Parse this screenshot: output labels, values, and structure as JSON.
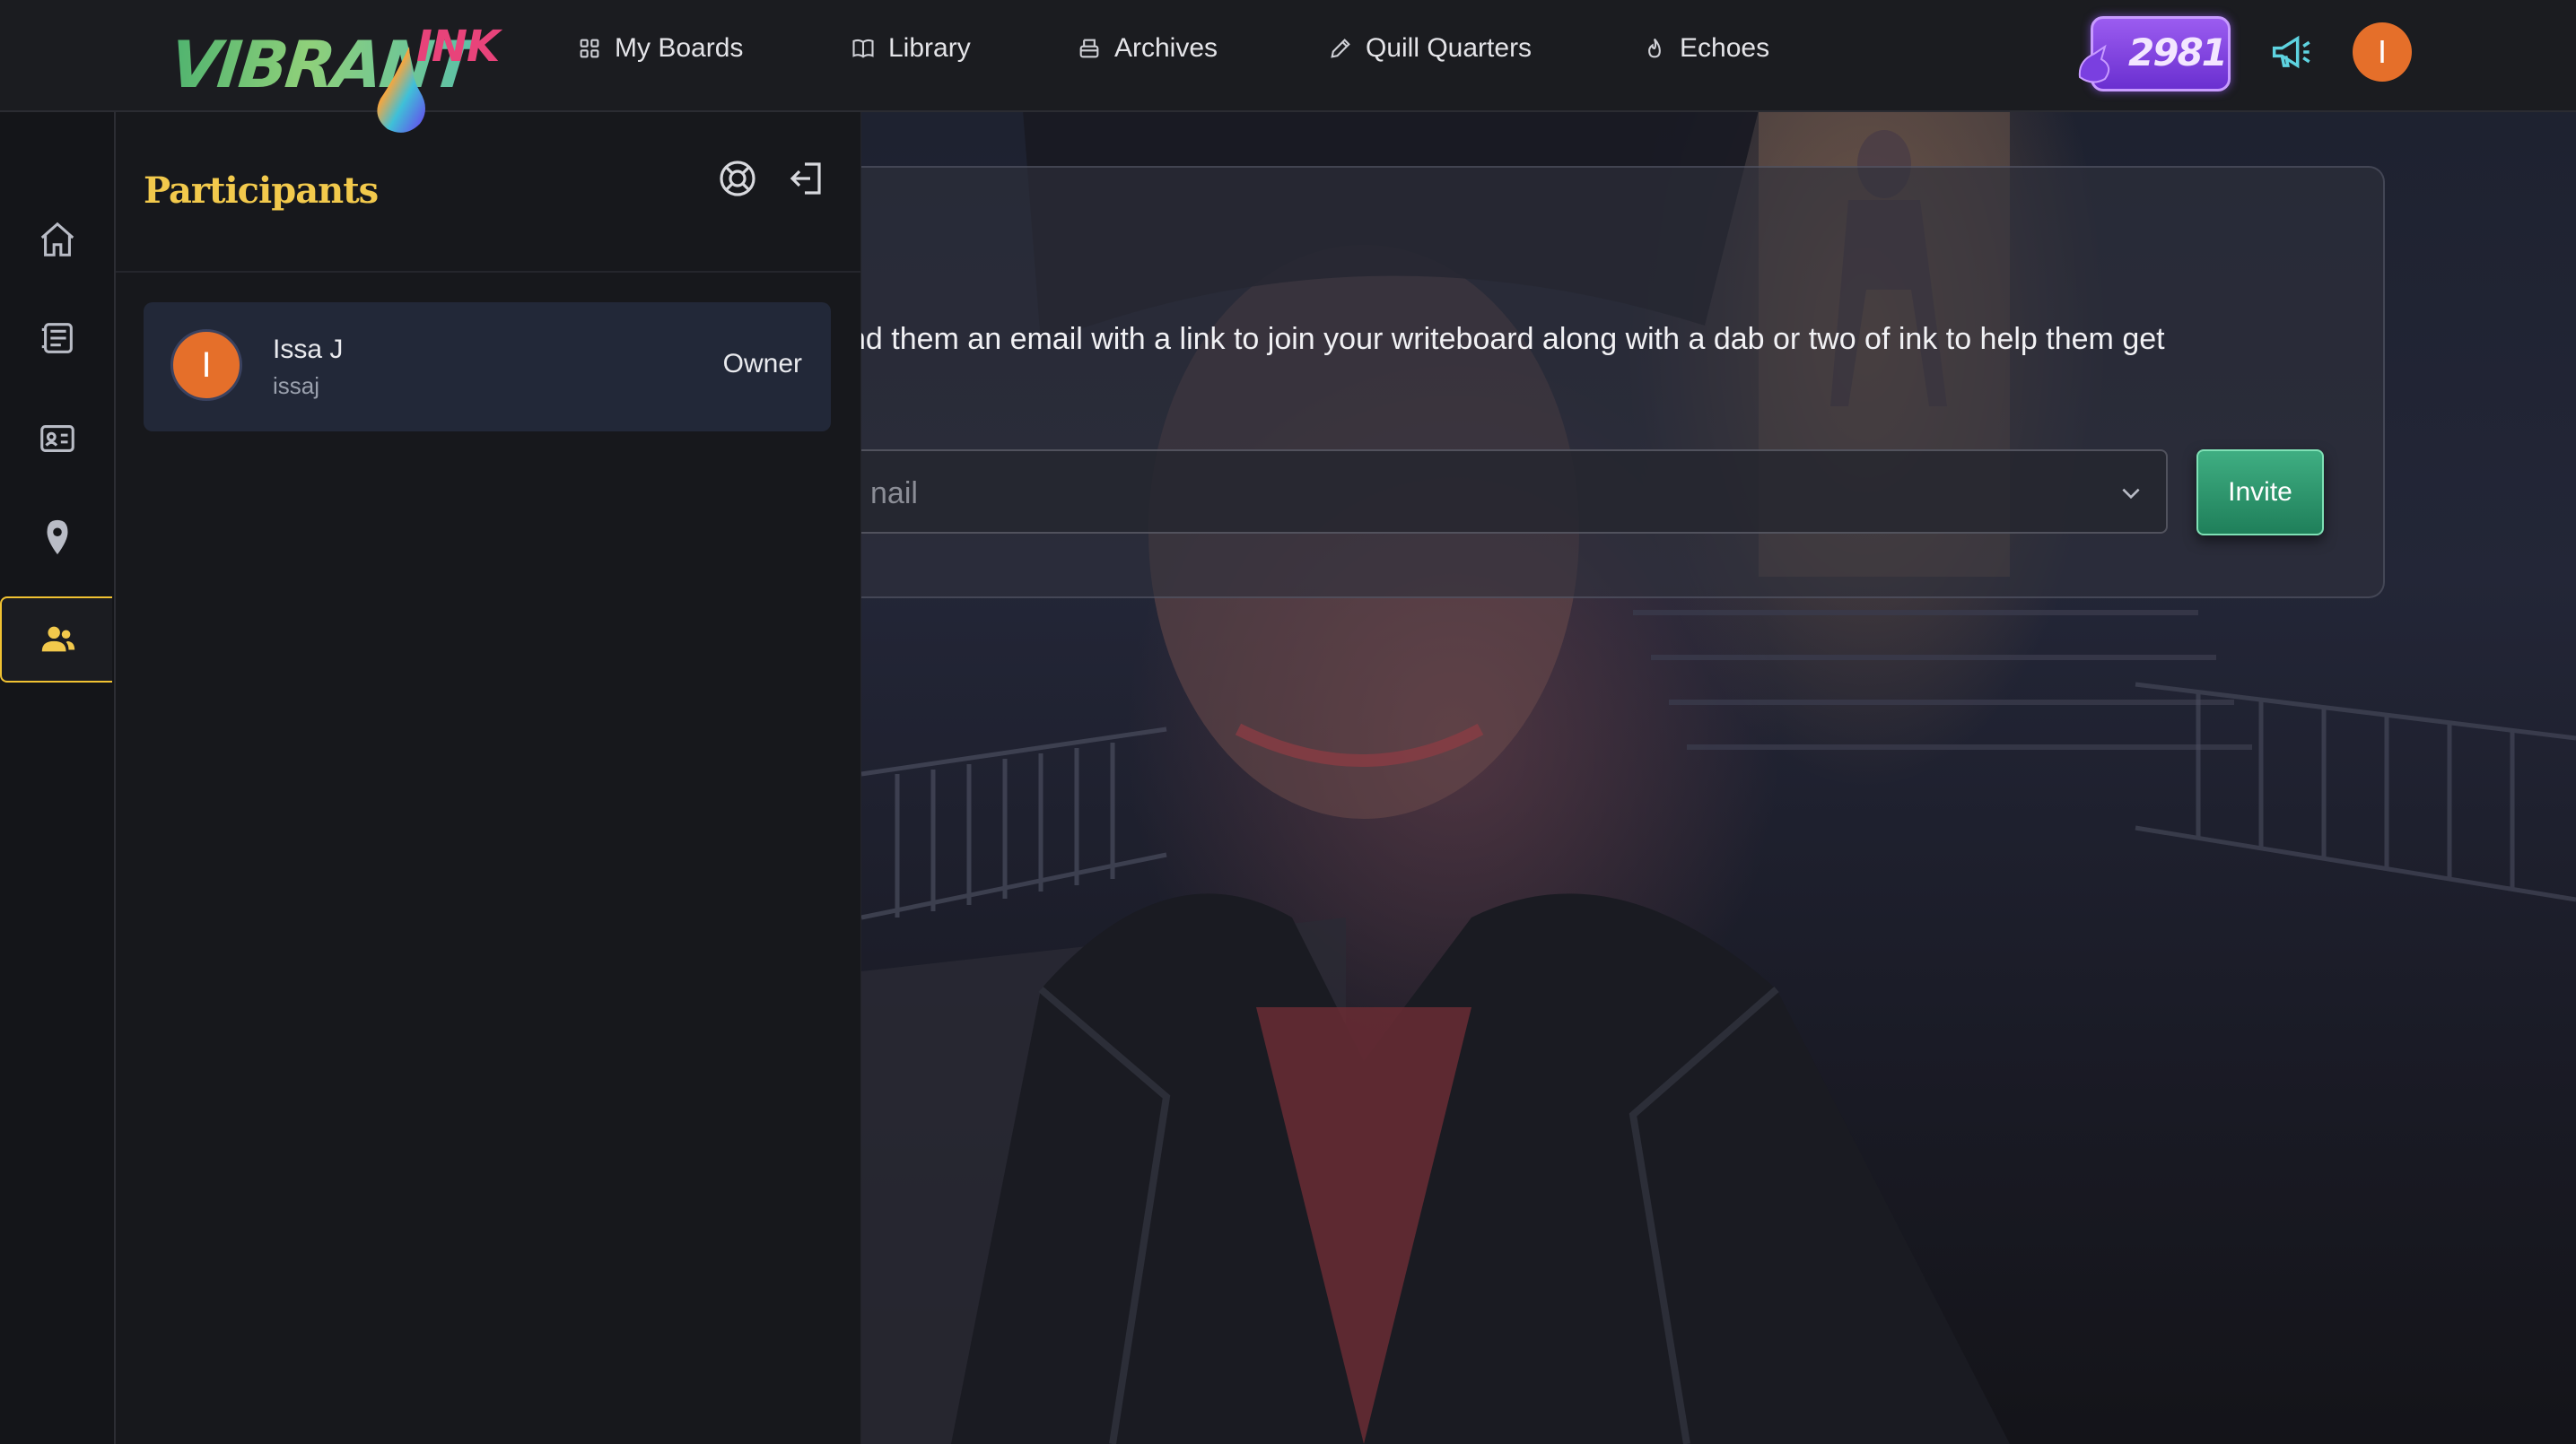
{
  "app": {
    "logo_text": "VIBRANT",
    "logo_accent": "INK",
    "brand_colors": {
      "accent_yellow": "#f2c94c",
      "orange": "#e56f2a",
      "purple": "#8a4ff0",
      "green": "#2f9c70"
    }
  },
  "header": {
    "nav": [
      {
        "label": "My Boards",
        "icon": "grid-icon"
      },
      {
        "label": "Library",
        "icon": "book-icon"
      },
      {
        "label": "Archives",
        "icon": "archive-icon"
      },
      {
        "label": "Quill Quarters",
        "icon": "pencil-icon"
      },
      {
        "label": "Echoes",
        "icon": "flame-icon"
      }
    ],
    "credits": "2981",
    "avatar_initial": "I"
  },
  "rail": {
    "items": [
      {
        "icon": "home-icon",
        "active": false
      },
      {
        "icon": "document-icon",
        "active": false
      },
      {
        "icon": "contact-card-icon",
        "active": false
      },
      {
        "icon": "location-pin-icon",
        "active": false
      },
      {
        "icon": "participants-icon",
        "active": true
      }
    ]
  },
  "panel": {
    "title": "Participants",
    "participants": [
      {
        "initial": "I",
        "name": "Issa J",
        "handle": "issaj",
        "role": "Owner"
      }
    ]
  },
  "invite": {
    "text": "nd them an email with a link to join your writeboard along with a dab or two of ink to help them get",
    "email_placeholder": "nail",
    "button_label": "Invite"
  }
}
